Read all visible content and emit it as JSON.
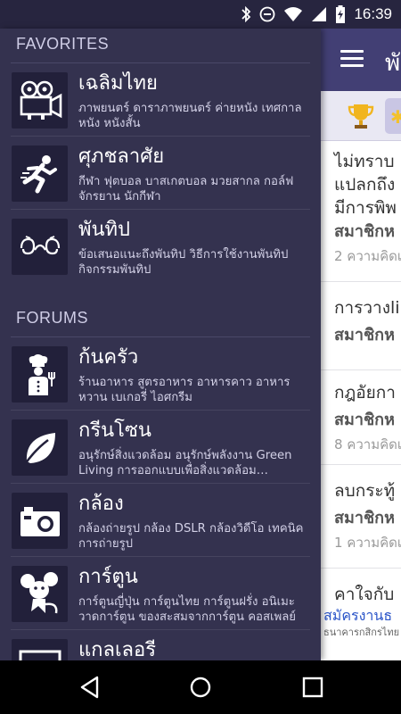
{
  "status": {
    "time": "16:39"
  },
  "main": {
    "title": "พั",
    "topics": [
      {
        "title_lines": [
          "ไม่ทราบ",
          "แปลกถึง",
          "มีการพิพ"
        ],
        "author": "สมาชิกห",
        "meta": "2 ความคิดเ"
      },
      {
        "title_lines": [
          "การวางli"
        ],
        "author": "สมาชิกห",
        "meta": ""
      },
      {
        "title_lines": [
          "กฎอัยกา"
        ],
        "author": "สมาชิกห",
        "meta": "8 ความคิดเ"
      },
      {
        "title_lines": [
          "ลบกระทู้"
        ],
        "author": "สมาชิกห",
        "meta": "1 ความคิดเ"
      }
    ],
    "ad": {
      "title": "คาใจกับ",
      "sub": "สมัครงานธ",
      "tiny": "ธนาคารกสิกรไทย"
    }
  },
  "drawer": {
    "favorites_header": "FAVORITES",
    "forums_header": "FORUMS",
    "favorites": [
      {
        "title": "เฉลิมไทย",
        "desc": "ภาพยนตร์ ดาราภาพยนตร์ ค่ายหนัง เทศกาลหนัง หนังสั้น",
        "icon": "movie-camera-icon"
      },
      {
        "title": "ศุภชลาศัย",
        "desc": "กีฬา ฟุตบอล บาสเกตบอล มวยสากล กอล์ฟ จักรยาน นักกีฬา",
        "icon": "runner-icon"
      },
      {
        "title": "พันทิป",
        "desc": "ข้อเสนอแนะถึงพันทิป วิธีการใช้งานพันทิป กิจกรรมพันทิป",
        "icon": "pantip-logo-icon"
      }
    ],
    "forums": [
      {
        "title": "ก้นครัว",
        "desc": "ร้านอาหาร สูตรอาหาร อาหารคาว อาหารหวาน เบเกอรี่ ไอศกรีม",
        "icon": "chef-icon"
      },
      {
        "title": "กรีนโซน",
        "desc": "อนุรักษ์สิ่งแวดล้อม อนุรักษ์พลังงาน Green Living การออกแบบเพื่อสิ่งแวดล้อม…",
        "icon": "leaf-icon"
      },
      {
        "title": "กล้อง",
        "desc": "กล้องถ่ายรูป กล้อง DSLR กล้องวิดีโอ เทคนิคการถ่ายรูป",
        "icon": "camera-icon"
      },
      {
        "title": "การ์ตูน",
        "desc": "การ์ตูนญี่ปุ่น การ์ตูนไทย การ์ตูนฝรั่ง อนิเมะ วาดการ์ตูน ของสะสมจากการ์ตูน คอสเพลย์",
        "icon": "cartoon-mouse-icon"
      },
      {
        "title": "แกลเลอรี",
        "desc": "",
        "icon": "frame-icon"
      }
    ]
  }
}
